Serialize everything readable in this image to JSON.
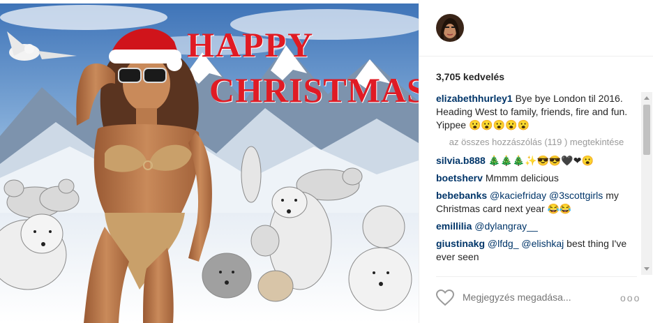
{
  "photo": {
    "headline_line1": "HAPPY",
    "headline_line2": "CHRISTMAS"
  },
  "side": {
    "likes": "3,705 kedvelés",
    "comments": [
      {
        "user": "elizabethhurley1",
        "text": "Bye bye London til 2016. Heading West to family, friends, fire and fun. Yippee 😮😮😮😮😮"
      },
      {
        "user": "silvia.b888",
        "text": "🎄🎄🎄✨😎😎🖤❤😮"
      },
      {
        "user": "boetsherv",
        "text": "Mmmm delicious"
      },
      {
        "user": "bebebanks",
        "mention": "@kaciefriday @3scottgirls",
        "text": "my Christmas card next year 😂😂"
      },
      {
        "user": "emillilia",
        "mention": "@dylangray__",
        "text": ""
      },
      {
        "user": "giustinakg",
        "mention": "@lfdg_ @elishkaj",
        "text": "best thing I've ever seen"
      }
    ],
    "load_more": "az összes hozzászólás (119 ) megtekintése",
    "add_comment_placeholder": "Megjegyzés megadása...",
    "more_options": "ooo"
  },
  "colors": {
    "username": "#003569",
    "muted": "#999999",
    "headline": "#e01b24"
  }
}
